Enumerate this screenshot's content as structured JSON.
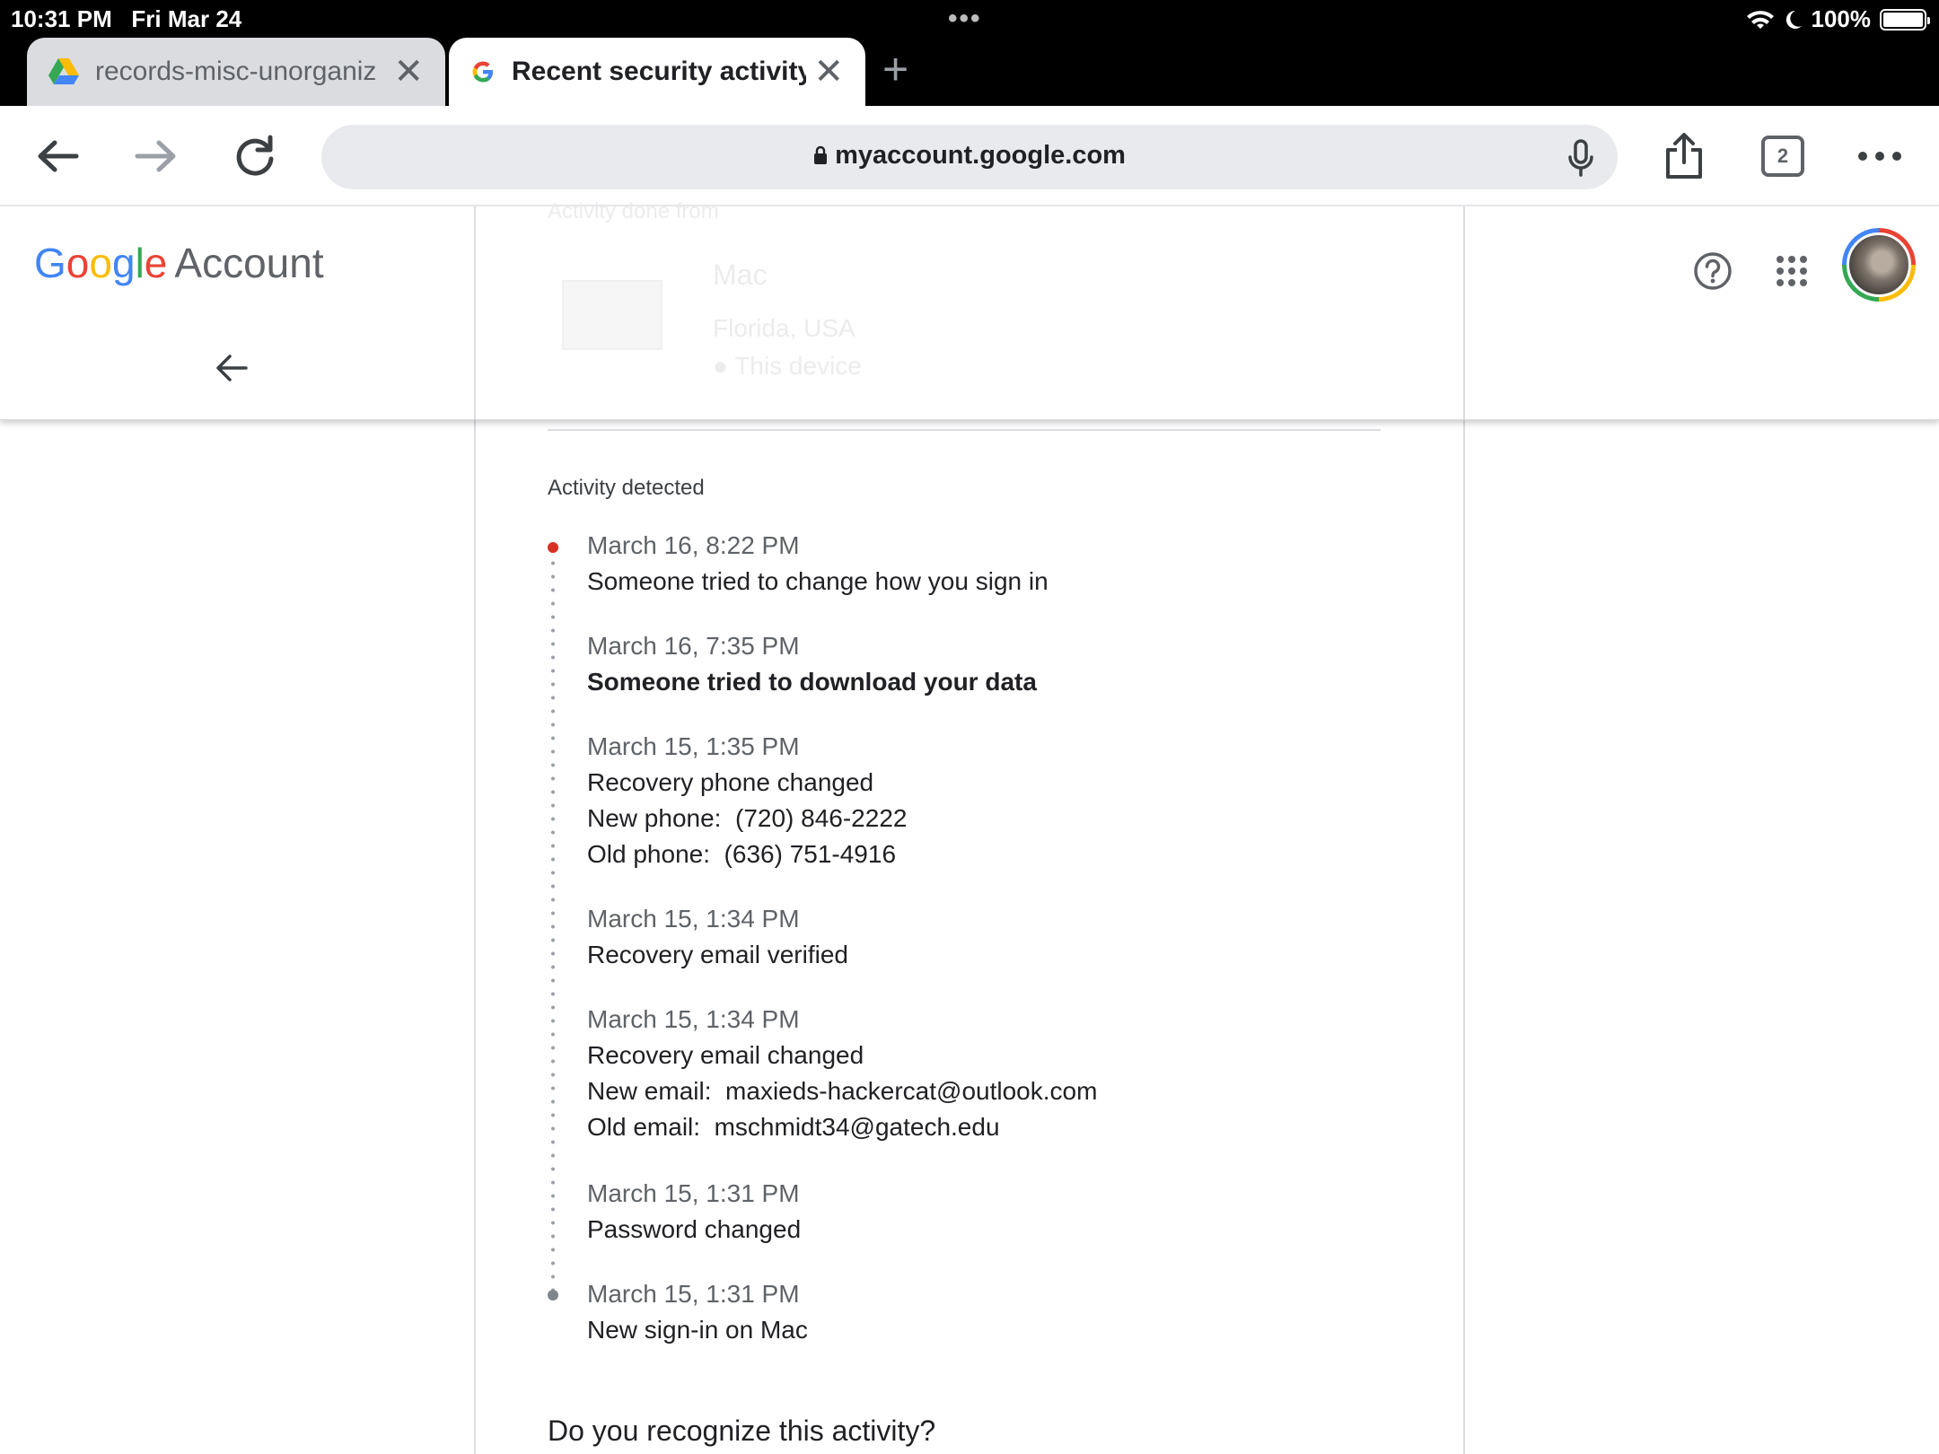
{
  "status_bar": {
    "time": "10:31 PM",
    "date": "Fri Mar 24",
    "battery": "100%",
    "wifi_icon": "wifi-icon",
    "moon_icon": "moon-icon"
  },
  "tabs": [
    {
      "title": "records-misc-unorganiz",
      "icon": "google-drive-icon",
      "active": false
    },
    {
      "title": "Recent security activity",
      "icon": "google-g-icon",
      "active": true
    }
  ],
  "toolbar": {
    "url": "myaccount.google.com",
    "tab_count": "2"
  },
  "header": {
    "logo_google": "Google",
    "logo_account": "Account"
  },
  "ghost": {
    "activity_from": "Activity done from",
    "device": "Mac",
    "location": "Florida, USA",
    "this_device": "This device"
  },
  "activity": {
    "section_label": "Activity detected",
    "events": [
      {
        "date": "March 16, 8:22 PM",
        "lines": [
          "Someone tried to change how you sign in"
        ]
      },
      {
        "date": "March 16, 7:35 PM",
        "lines": [
          "Someone tried to download your data"
        ]
      },
      {
        "date": "March 15, 1:35 PM",
        "lines": [
          "Recovery phone changed",
          "New phone:  (720) 846-2222",
          "Old phone:  (636) 751-4916"
        ]
      },
      {
        "date": "March 15, 1:34 PM",
        "lines": [
          "Recovery email verified"
        ]
      },
      {
        "date": "March 15, 1:34 PM",
        "lines": [
          "Recovery email changed",
          "New email:  maxieds-hackercat@outlook.com",
          "Old email:  mschmidt34@gatech.edu"
        ]
      },
      {
        "date": "March 15, 1:31 PM",
        "lines": [
          "Password changed"
        ]
      },
      {
        "date": "March 15, 1:31 PM",
        "lines": [
          "New sign-in on Mac"
        ]
      }
    ],
    "question": "Do you recognize this activity?"
  },
  "colors": {
    "google_blue": "#4285f4",
    "google_red": "#ea4335",
    "google_yellow": "#fbbc05",
    "google_green": "#34a853",
    "alert_red": "#d93025"
  }
}
